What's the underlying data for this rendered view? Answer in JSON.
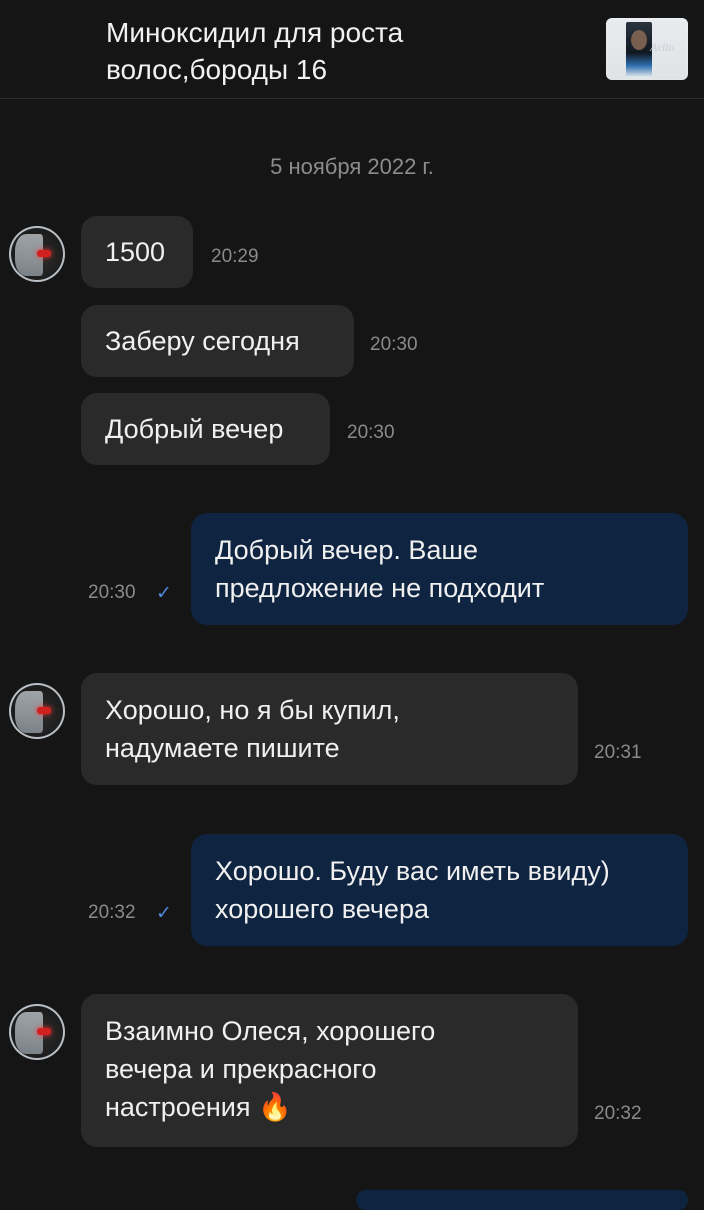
{
  "header": {
    "title": "Миноксидил для роста\nволос,бороды 16",
    "thumbnail_watermark": "Avito"
  },
  "date_separator": "5 ноября 2022 г.",
  "messages": [
    {
      "dir": "in",
      "text": "1500",
      "time": "20:29"
    },
    {
      "dir": "in",
      "text": "Заберу сегодня",
      "time": "20:30"
    },
    {
      "dir": "in",
      "text": "Добрый вечер",
      "time": "20:30"
    },
    {
      "dir": "out",
      "text": "Добрый вечер. Ваше\nпредложение не подходит",
      "time": "20:30",
      "status": "✓"
    },
    {
      "dir": "in",
      "text": "Хорошо, но я бы купил,\nнадумаете пишите",
      "time": "20:31"
    },
    {
      "dir": "out",
      "text": "Хорошо. Буду вас иметь ввиду)\nхорошего вечера",
      "time": "20:32",
      "status": "✓"
    },
    {
      "dir": "in",
      "text": "Взаимно Олеся, хорошего\nвечера и прекрасного\nнастроения",
      "emoji": "🔥",
      "time": "20:32"
    }
  ],
  "colors": {
    "background": "#151515",
    "incoming_bubble": "#2a2a2a",
    "outgoing_bubble": "#0f2440",
    "read_check": "#4a86d8"
  }
}
